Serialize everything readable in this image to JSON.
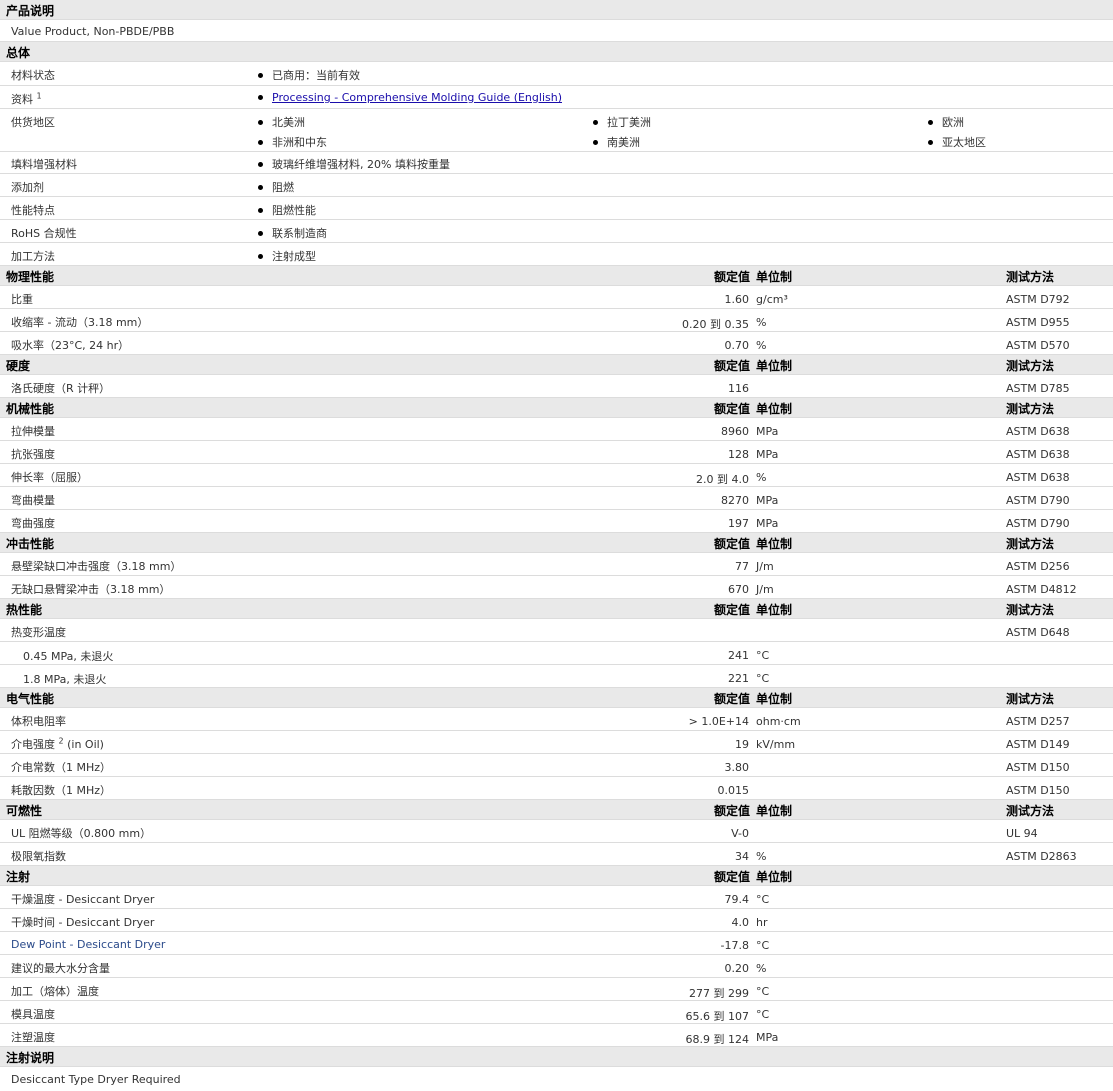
{
  "desc": {
    "title": "产品说明",
    "text": "Value Product, Non-PBDE/PBB"
  },
  "general": {
    "title": "总体",
    "material_status": {
      "label": "材料状态",
      "value": "已商用：当前有效"
    },
    "literature": {
      "label": "资料",
      "sup": "1",
      "link": "Processing - Comprehensive Molding Guide (English)"
    },
    "supply": {
      "label": "供货地区",
      "regions": [
        "北美洲",
        "拉丁美洲",
        "欧洲",
        "非洲和中东",
        "南美洲",
        "亚太地区"
      ]
    },
    "filler": {
      "label": "填料增强材料",
      "value": "玻璃纤维增强材料, 20% 填料按重量"
    },
    "additive": {
      "label": "添加剂",
      "value": "阻燃"
    },
    "features": {
      "label": "性能特点",
      "value": "阻燃性能"
    },
    "rohs": {
      "label": "RoHS 合规性",
      "value": "联系制造商"
    },
    "processing": {
      "label": "加工方法",
      "value": "注射成型"
    }
  },
  "headers": {
    "value": "额定值",
    "unit": "单位制",
    "test": "测试方法"
  },
  "physical": {
    "title": "物理性能",
    "rows": [
      {
        "label": "比重",
        "value": "1.60",
        "unit": "g/cm³",
        "test": "ASTM D792"
      },
      {
        "label": "收缩率  - 流动（3.18 mm）",
        "value": "0.20 到  0.35",
        "unit": "%",
        "test": "ASTM D955"
      },
      {
        "label": "吸水率（23°C, 24 hr）",
        "value": "0.70",
        "unit": "%",
        "test": "ASTM D570"
      }
    ]
  },
  "hardness": {
    "title": "硬度",
    "rows": [
      {
        "label": "洛氏硬度（R 计秤）",
        "value": "116",
        "unit": "",
        "test": "ASTM D785"
      }
    ]
  },
  "mechanical": {
    "title": "机械性能",
    "rows": [
      {
        "label": "拉伸模量",
        "value": "8960",
        "unit": "MPa",
        "test": "ASTM D638"
      },
      {
        "label": "抗张强度",
        "value": "128",
        "unit": "MPa",
        "test": "ASTM D638"
      },
      {
        "label": "伸长率（屈服）",
        "value": "2.0 到  4.0",
        "unit": "%",
        "test": "ASTM D638"
      },
      {
        "label": "弯曲模量",
        "value": "8270",
        "unit": "MPa",
        "test": "ASTM D790"
      },
      {
        "label": "弯曲强度",
        "value": "197",
        "unit": "MPa",
        "test": "ASTM D790"
      }
    ]
  },
  "impact": {
    "title": "冲击性能",
    "rows": [
      {
        "label": "悬壁梁缺口冲击强度（3.18 mm）",
        "value": "77",
        "unit": "J/m",
        "test": "ASTM D256"
      },
      {
        "label": "无缺口悬臂梁冲击（3.18 mm）",
        "value": "670",
        "unit": "J/m",
        "test": "ASTM D4812"
      }
    ]
  },
  "thermal": {
    "title": "热性能",
    "hdt": {
      "label": "热变形温度",
      "test": "ASTM D648"
    },
    "rows": [
      {
        "label": "0.45 MPa, 未退火",
        "value": "241",
        "unit": "°C",
        "test": ""
      },
      {
        "label": "1.8 MPa, 未退火",
        "value": "221",
        "unit": "°C",
        "test": ""
      }
    ]
  },
  "electrical": {
    "title": "电气性能",
    "r0": {
      "label": "体积电阻率",
      "value": "> 1.0E+14",
      "unit": "ohm·cm",
      "test": "ASTM D257"
    },
    "r1": {
      "label": "介电强度",
      "sup": "2",
      "label2": "(in Oil)",
      "value": "19",
      "unit": "kV/mm",
      "test": "ASTM D149"
    },
    "r2": {
      "label": "介电常数（1 MHz）",
      "value": "3.80",
      "unit": "",
      "test": "ASTM D150"
    },
    "r3": {
      "label": "耗散因数（1 MHz）",
      "value": "0.015",
      "unit": "",
      "test": "ASTM D150"
    }
  },
  "flammability": {
    "title": "可燃性",
    "rows": [
      {
        "label": "UL 阻燃等级（0.800 mm）",
        "value": "V-0",
        "unit": "",
        "test": "UL 94"
      },
      {
        "label": "极限氧指数",
        "value": "34",
        "unit": "%",
        "test": "ASTM D2863"
      }
    ]
  },
  "injection": {
    "title": "注射",
    "rows": [
      {
        "label": "干燥温度  - Desiccant Dryer",
        "value": "79.4",
        "unit": "°C"
      },
      {
        "label": "干燥时间  - Desiccant Dryer",
        "value": "4.0",
        "unit": "hr"
      },
      {
        "label": "Dew Point - Desiccant Dryer",
        "value": "-17.8",
        "unit": "°C"
      },
      {
        "label": "建议的最大水分含量",
        "value": "0.20",
        "unit": "%"
      },
      {
        "label": "加工（熔体）温度",
        "value": "277 到  299",
        "unit": "°C"
      },
      {
        "label": "模具温度",
        "value": "65.6 到  107",
        "unit": "°C"
      },
      {
        "label": "注塑温度",
        "value": "68.9 到  124",
        "unit": "MPa"
      }
    ]
  },
  "notes": {
    "title": "注射说明",
    "text": "Desiccant Type Dryer Required"
  }
}
